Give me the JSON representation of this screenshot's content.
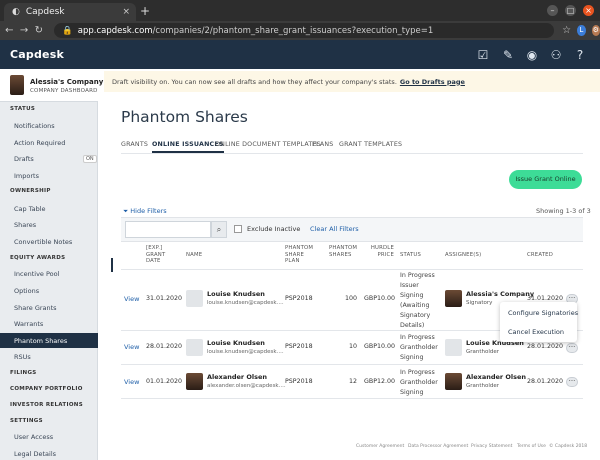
{
  "browser": {
    "tab_title": "Capdesk",
    "tab_close": "×",
    "new_tab": "+",
    "url_host": "app.capdesk.com",
    "url_path": "/companies/2/phantom_share_grant_issuances?execution_type=1",
    "profile_initial": "L"
  },
  "app": {
    "logo": "Capdesk",
    "colors": {
      "header": "#1f3145",
      "accent": "#3ddc97",
      "link": "#1f5fa8"
    }
  },
  "sidebar": {
    "company_name": "Alessia's Company",
    "company_sub": "COMPANY DASHBOARD",
    "sections": [
      {
        "title": "STATUS",
        "items": [
          "Notifications",
          "Action Required",
          "Drafts",
          "Imports"
        ]
      },
      {
        "title": "OWNERSHIP",
        "items": [
          "Cap Table",
          "Shares",
          "Convertible Notes"
        ]
      },
      {
        "title": "EQUITY AWARDS",
        "items": [
          "Incentive Pool",
          "Options",
          "Share Grants",
          "Warrants",
          "Phantom Shares",
          "RSUs"
        ]
      },
      {
        "title": "FILINGS",
        "items": []
      },
      {
        "title": "COMPANY PORTFOLIO",
        "items": []
      },
      {
        "title": "INVESTOR RELATIONS",
        "items": []
      },
      {
        "title": "SETTINGS",
        "items": [
          "User Access",
          "Legal Details"
        ]
      }
    ],
    "drafts_badge": "ON",
    "active_item": "Phantom Shares"
  },
  "banner": {
    "text": "Draft visibility on. You can now see all drafts and how they affect your company's stats.",
    "link": "Go to Drafts page"
  },
  "page": {
    "title": "Phantom Shares",
    "tabs": [
      "GRANTS",
      "ONLINE ISSUANCES",
      "ONLINE DOCUMENT TEMPLATES",
      "PLANS",
      "GRANT TEMPLATES"
    ],
    "active_tab": "ONLINE ISSUANCES",
    "issue_button": "Issue Grant Online",
    "hide_filters": "Hide Filters",
    "showing": "Showing 1-3 of 3",
    "search_placeholder": "",
    "exclude_inactive": "Exclude Inactive",
    "clear_filters": "Clear All Filters"
  },
  "table": {
    "headers": [
      "[EXP.] GRANT DATE",
      "NAME",
      "PHANTOM SHARE PLAN",
      "PHANTOM SHARES",
      "HURDLE PRICE",
      "STATUS",
      "ASSIGNEE(S)",
      "CREATED"
    ],
    "rows": [
      {
        "action": "View",
        "date": "31.01.2020",
        "name": "Louise Knudsen",
        "email": "louise.knudsen@capdesk....",
        "plan": "PSP2018",
        "shares": "100",
        "price": "GBP10.00",
        "status": "In Progress Issuer Signing (Awaiting Signatory Details)",
        "assignee": "Alessia's Company",
        "role": "Signatory",
        "created": "31.01.2020"
      },
      {
        "action": "View",
        "date": "28.01.2020",
        "name": "Louise Knudsen",
        "email": "louise.knudsen@capdesk....",
        "plan": "PSP2018",
        "shares": "10",
        "price": "GBP10.00",
        "status": "In Progress Grantholder Signing",
        "assignee": "Louise Knudsen",
        "role": "Grantholder",
        "created": "28.01.2020"
      },
      {
        "action": "View",
        "date": "01.01.2020",
        "name": "Alexander Olsen",
        "email": "alexander.olsen@capdesk....",
        "plan": "PSP2018",
        "shares": "12",
        "price": "GBP12.00",
        "status": "In Progress Grantholder Signing",
        "assignee": "Alexander Olsen",
        "role": "Grantholder",
        "created": "28.01.2020"
      }
    ],
    "more_glyph": "···"
  },
  "context_menu": {
    "items": [
      "Configure Signatories",
      "Cancel Execution"
    ]
  },
  "footer": {
    "links": [
      "Customer Agreement",
      "Data Processor Agreement",
      "Privacy Statement",
      "Terms of Use"
    ],
    "copyright": "© Capdesk 2018"
  }
}
